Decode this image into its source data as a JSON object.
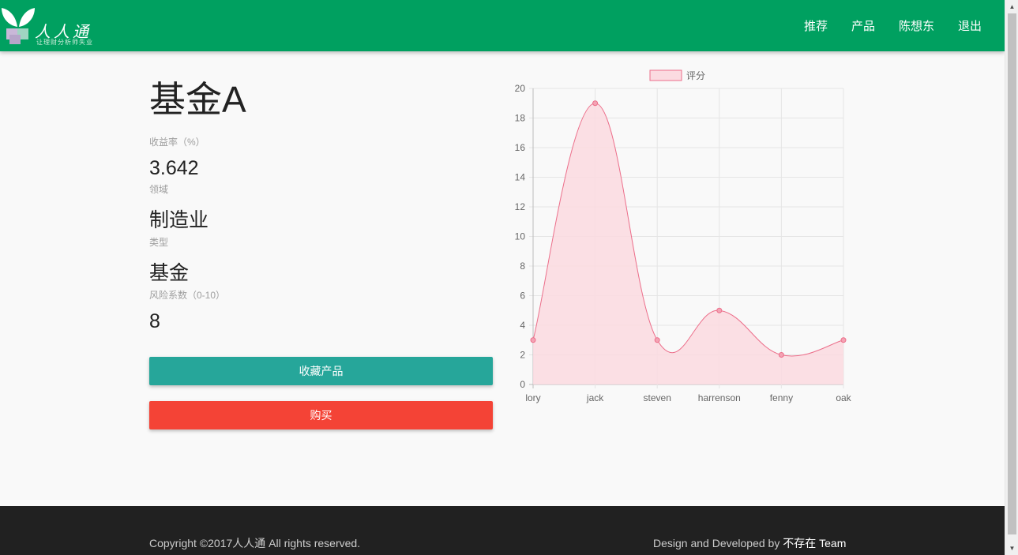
{
  "header": {
    "logo_text": "人人通",
    "logo_slogan": "让理财分析师失业",
    "nav": [
      "推荐",
      "产品",
      "陈想东",
      "退出"
    ]
  },
  "product": {
    "title": "基金A",
    "fields": [
      {
        "label": "收益率（%）",
        "value": "3.642"
      },
      {
        "label": "领域",
        "value": "制造业"
      },
      {
        "label": "类型",
        "value": "基金"
      },
      {
        "label": "风险系数（0-10）",
        "value": "8"
      }
    ],
    "favorite_label": "收藏产品",
    "buy_label": "购买"
  },
  "colors": {
    "navbar": "#00a060",
    "favorite_button": "#26a69a",
    "buy_button": "#f44336",
    "series_line": "#ec6e8a",
    "series_fill": "#fbdbe1"
  },
  "chart_data": {
    "type": "line",
    "categories": [
      "lory",
      "jack",
      "steven",
      "harrenson",
      "fenny",
      "oak"
    ],
    "series": [
      {
        "name": "评分",
        "values": [
          3,
          19,
          3,
          5,
          2,
          3
        ]
      }
    ],
    "ylim": [
      0,
      20
    ],
    "yticks": [
      0,
      2,
      4,
      6,
      8,
      10,
      12,
      14,
      16,
      18,
      20
    ],
    "grid": true,
    "legend": "top",
    "fill": true,
    "smooth": true
  },
  "footer": {
    "copyright": "Copyright ©2017人人通 All rights reserved.",
    "credit_prefix": "Design and Developed by ",
    "credit_team": "不存在 Team"
  }
}
